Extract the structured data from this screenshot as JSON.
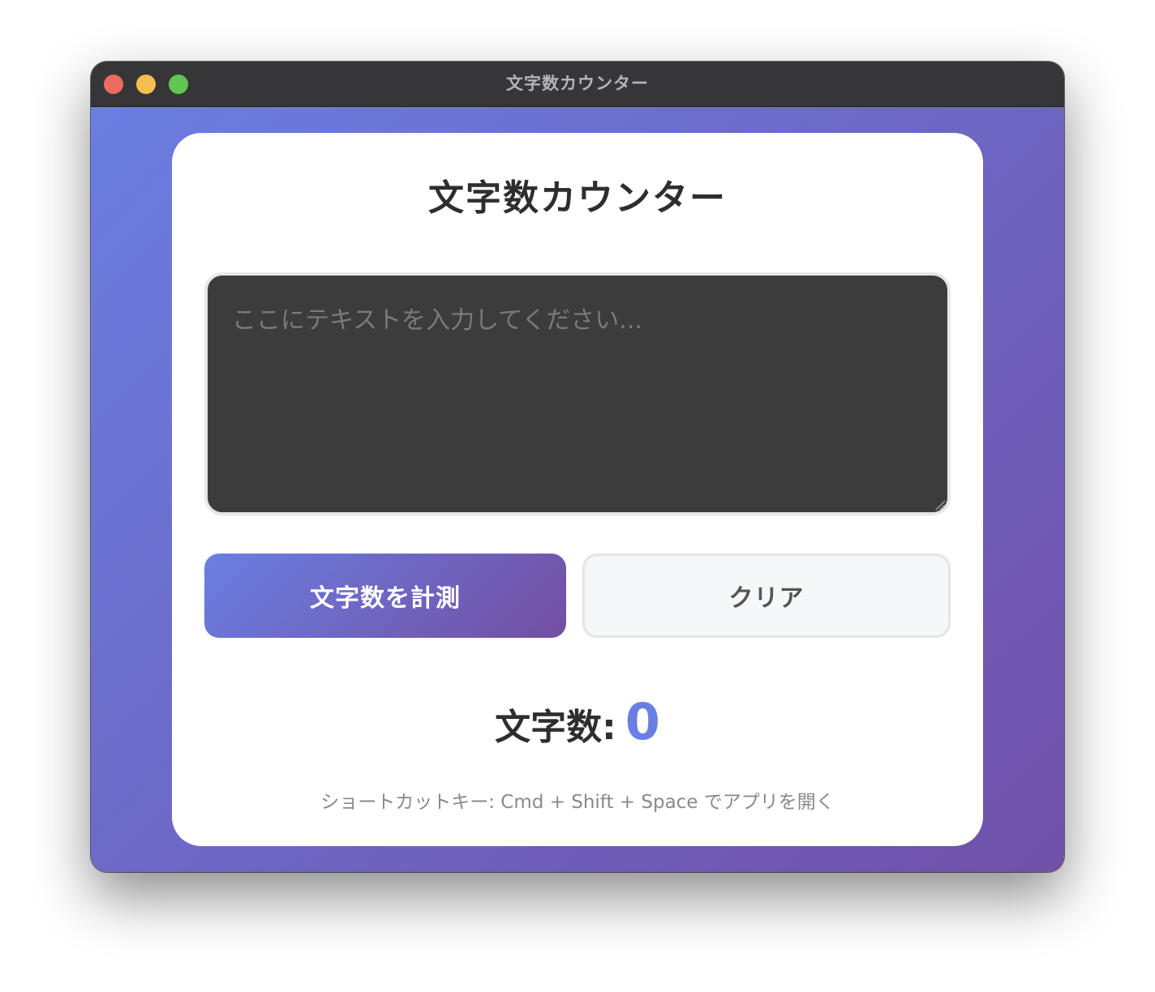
{
  "window": {
    "title": "文字数カウンター"
  },
  "app": {
    "heading": "文字数カウンター",
    "input": {
      "placeholder": "ここにテキストを入力してください...",
      "value": ""
    },
    "buttons": {
      "count_label": "文字数を計測",
      "clear_label": "クリア"
    },
    "result": {
      "label": "文字数:",
      "value": "0"
    },
    "hint": "ショートカットキー: Cmd + Shift + Space でアプリを開く"
  },
  "colors": {
    "gradient_start": "#6a7fe2",
    "gradient_end": "#7050a8",
    "count_value": "#6a7fe2",
    "textarea_bg": "#3c3c3c",
    "close": "#ed6a5e",
    "minimize": "#f5bf4f",
    "maximize": "#61c554"
  },
  "icons": [
    "close-icon",
    "minimize-icon",
    "maximize-icon",
    "resize-grip-icon"
  ]
}
